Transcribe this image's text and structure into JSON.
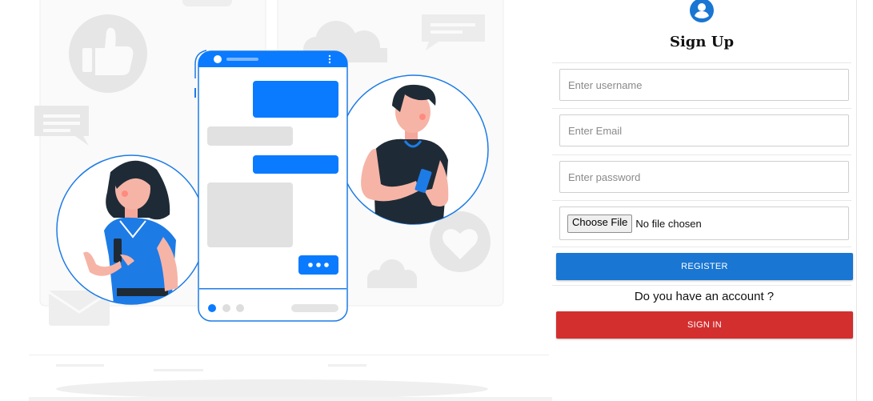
{
  "form": {
    "title": "Sign Up",
    "username_placeholder": "Enter username",
    "email_placeholder": "Enter Email",
    "password_placeholder": "Enter password",
    "file_button": "Choose File",
    "file_status": "No file chosen",
    "register_label": "REGISTER",
    "account_prompt": "Do you have an account ?",
    "signin_label": "SIGN IN"
  },
  "colors": {
    "primary": "#1976d2",
    "danger": "#d32f2f",
    "accent_blue": "#0a7bff",
    "illustration_gray": "#e4e4e4"
  },
  "icons": {
    "avatar": "user-circle-icon",
    "like": "thumbs-up-icon",
    "heart": "heart-icon",
    "mail": "envelope-icon",
    "cloud": "cloud-icon",
    "message": "chat-bubble-icon"
  }
}
